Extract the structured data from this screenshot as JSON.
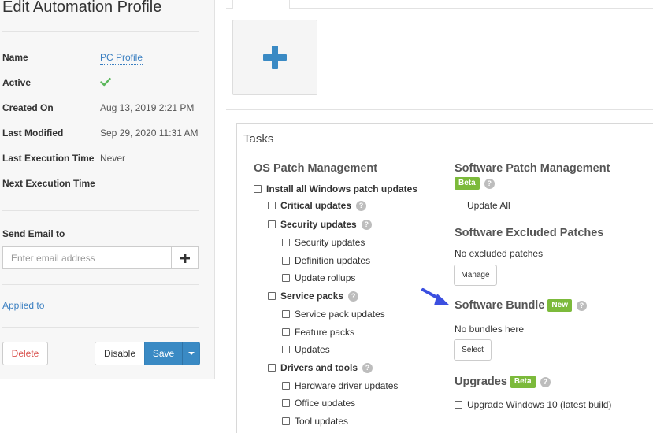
{
  "profile": {
    "title": "Edit Automation Profile",
    "fields": {
      "name_label": "Name",
      "name_value": "PC Profile",
      "active_label": "Active",
      "created_label": "Created On",
      "created_value": "Aug 13, 2019 2:21 PM",
      "modified_label": "Last Modified",
      "modified_value": "Sep 29, 2020 11:31 AM",
      "last_exec_label": "Last Execution Time",
      "last_exec_value": "Never",
      "next_exec_label": "Next Execution Time"
    },
    "email": {
      "label": "Send Email to",
      "placeholder": "Enter email address"
    },
    "applied_to": "Applied to",
    "buttons": {
      "delete": "Delete",
      "disable": "Disable",
      "save": "Save"
    }
  },
  "tasks": {
    "title": "Tasks",
    "os_patch": {
      "heading": "OS Patch Management",
      "install_all": "Install all Windows patch updates",
      "critical": "Critical updates",
      "security": "Security updates",
      "security_children": [
        "Security updates",
        "Definition updates",
        "Update rollups"
      ],
      "service_packs": "Service packs",
      "service_children": [
        "Service pack updates",
        "Feature packs",
        "Updates"
      ],
      "drivers": "Drivers and tools",
      "driver_children": [
        "Hardware driver updates",
        "Office updates",
        "Tool updates"
      ]
    },
    "software_patch": {
      "heading": "Software Patch Management",
      "badge": "Beta",
      "update_all": "Update All"
    },
    "excluded": {
      "heading": "Software Excluded Patches",
      "text": "No excluded patches",
      "button": "Manage"
    },
    "bundle": {
      "heading": "Software Bundle",
      "badge": "New",
      "text": "No bundles here",
      "button": "Select"
    },
    "upgrades": {
      "heading": "Upgrades",
      "badge": "Beta",
      "option": "Upgrade Windows 10 (latest build)"
    }
  },
  "colors": {
    "accent": "#3a8ac4",
    "badge_green": "#7cba3b",
    "link": "#3a7fc1",
    "delete_red": "#d9534f",
    "check_green": "#5cb85c",
    "arrow_blue": "#3b4fe0"
  },
  "icons": {
    "active": "check-icon",
    "add_email": "plus-icon",
    "add_task": "plus-icon",
    "save_menu": "caret-down-icon",
    "help": "question-circle-icon",
    "pointer": "arrow-icon"
  }
}
